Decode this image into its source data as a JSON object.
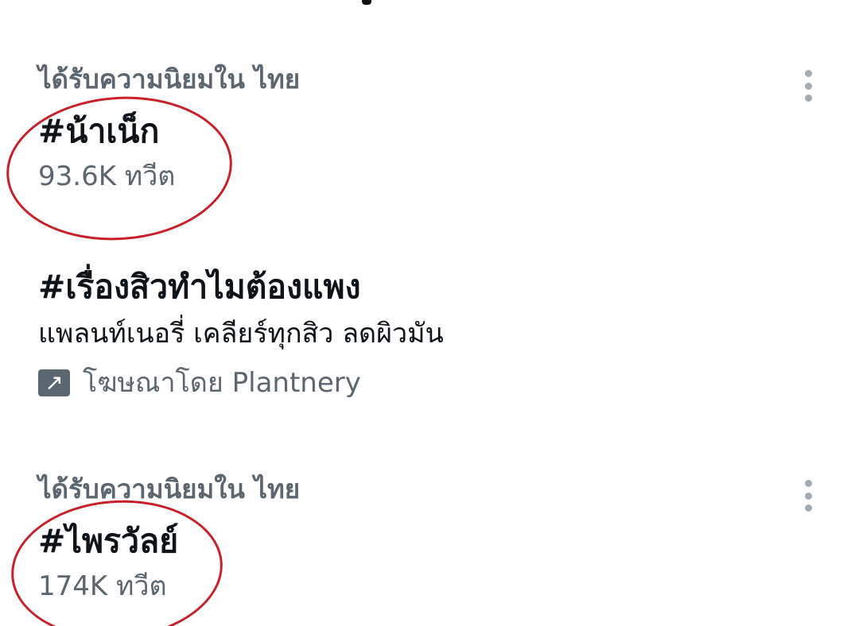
{
  "trends": [
    {
      "context": "ได้รับความนิยมใน ไทย",
      "hashtag": "#น้าเน็ก",
      "count": "93.6K ทวีต",
      "more_icon": "more-vertical-icon"
    },
    {
      "hashtag": "#เรื่องสิวทำไมต้องแพง",
      "description": "แพลนท์เนอรี่ เคลียร์ทุกสิว ลดผิวมัน",
      "promoted": "โฆษณาโดย Plantnery",
      "promoted_icon": "promoted-arrow-icon"
    },
    {
      "context": "ได้รับความนิยมใน ไทย",
      "hashtag": "#ไพรวัลย์",
      "count": "174K ทวีต",
      "more_icon": "more-vertical-icon"
    }
  ],
  "annotation_color": "#c8202a"
}
